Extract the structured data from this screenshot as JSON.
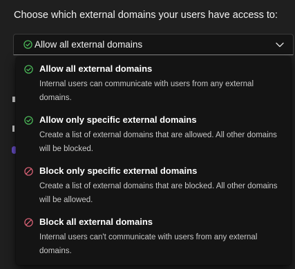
{
  "heading": "Choose which external domains your users have access to:",
  "select": {
    "value": "Allow all external domains",
    "value_icon": "check-circle-icon",
    "chevron_icon": "chevron-down-icon"
  },
  "options": [
    {
      "title": "Allow all external domains",
      "description": "Internal users can communicate with users from any external domains.",
      "icon": "check-circle-icon",
      "icon_color": "#4fc35d"
    },
    {
      "title": "Allow only specific external domains",
      "description": "Create a list of external domains that are allowed. All other domains will be blocked.",
      "icon": "check-circle-icon",
      "icon_color": "#4fc35d"
    },
    {
      "title": "Block only specific external domains",
      "description": "Create a list of external domains that are blocked. All other domains will be allowed.",
      "icon": "block-icon",
      "icon_color": "#e2657a"
    },
    {
      "title": "Block all external domains",
      "description": "Internal users can't communicate with users from any external domains.",
      "icon": "block-icon",
      "icon_color": "#e2657a"
    }
  ],
  "colors": {
    "background": "#1f1f1f",
    "dropdown_background": "#141414",
    "allow_green": "#4fc35d",
    "block_red": "#e2657a",
    "accent_purple": "#6a4fc9"
  }
}
